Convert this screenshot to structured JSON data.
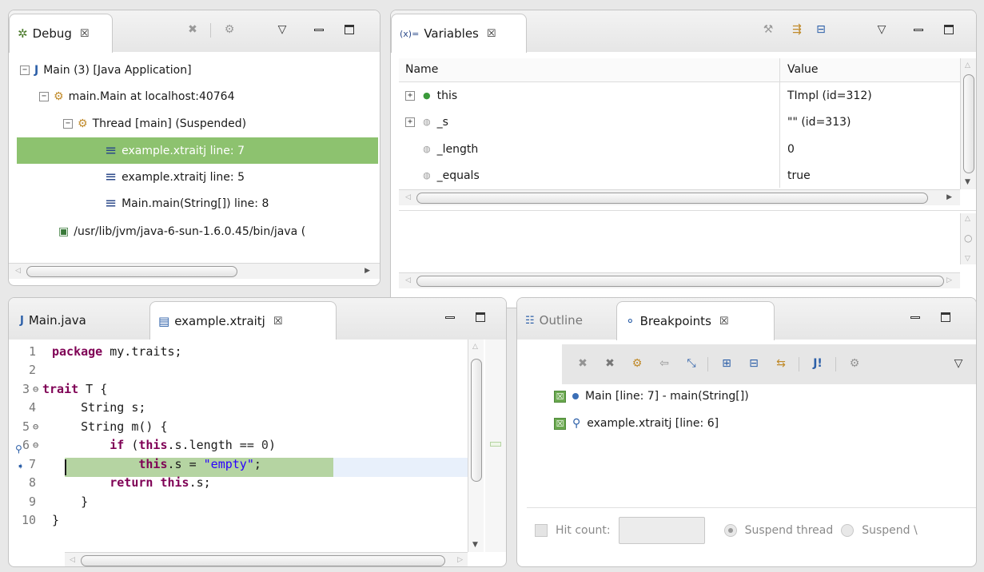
{
  "debug": {
    "tab_label": "Debug",
    "tab_close": "☒",
    "tree": [
      {
        "label": "Main (3) [Java Application]",
        "expander": "−"
      },
      {
        "label": "main.Main at localhost:40764",
        "expander": "−"
      },
      {
        "label": "Thread [main] (Suspended)",
        "expander": "−"
      },
      {
        "label": "example.xtraitj line: 7"
      },
      {
        "label": "example.xtraitj line: 5"
      },
      {
        "label": "Main.main(String[]) line: 8"
      },
      {
        "label": "/usr/lib/jvm/java-6-sun-1.6.0.45/bin/java ("
      }
    ]
  },
  "variables": {
    "tab_label": "Variables",
    "tab_prefix": "(x)=",
    "tab_close": "☒",
    "columns": {
      "name": "Name",
      "value": "Value"
    },
    "rows": [
      {
        "name": "this",
        "value": "TImpl  (id=312)",
        "expander": "+"
      },
      {
        "name": "_s",
        "value": "\"\" (id=313)",
        "expander": "+"
      },
      {
        "name": "_length",
        "value": "0"
      },
      {
        "name": "_equals",
        "value": "true"
      }
    ]
  },
  "editor": {
    "tabs": [
      {
        "label": "Main.java"
      },
      {
        "label": "example.xtraitj",
        "close": "☒"
      }
    ],
    "lines": [
      {
        "n": "1",
        "fold": ""
      },
      {
        "n": "2",
        "fold": ""
      },
      {
        "n": "3",
        "fold": "⊖"
      },
      {
        "n": "4",
        "fold": ""
      },
      {
        "n": "5",
        "fold": "⊖"
      },
      {
        "n": "6",
        "fold": "⊖"
      },
      {
        "n": "7",
        "fold": ""
      },
      {
        "n": "8",
        "fold": ""
      },
      {
        "n": "9",
        "fold": ""
      },
      {
        "n": "10",
        "fold": ""
      }
    ],
    "code": {
      "l1_kw": "package",
      "l1_rest": " my.traits;",
      "l3_kw": "trait",
      "l3_rest": " T {",
      "l4": "    String s;",
      "l5": "    String m() {",
      "l6_indent": "        ",
      "l6_kw": "if",
      "l6_a": " (",
      "l6_kw2": "this",
      "l6_b": ".s.length == ",
      "l6_num": "0",
      "l6_c": ")",
      "l7_indent": "            ",
      "l7_kw": "this",
      "l7_a": ".s = ",
      "l7_str": "\"empty\"",
      "l7_b": ";",
      "l8_indent": "        ",
      "l8_kw": "return",
      "l8_a": " ",
      "l8_kw2": "this",
      "l8_b": ".s;",
      "l9": "    }",
      "l10": "}"
    }
  },
  "outline": {
    "tab_outline": "Outline",
    "tab_breakpoints": "Breakpoints",
    "tab_close": "☒",
    "breakpoints": [
      {
        "label": "Main [line: 7] - main(String[])"
      },
      {
        "label": "example.xtraitj [line: 6]"
      }
    ],
    "hit_count_label": "Hit count:",
    "suspend_thread": "Suspend thread",
    "suspend_vm": "Suspend \\"
  }
}
